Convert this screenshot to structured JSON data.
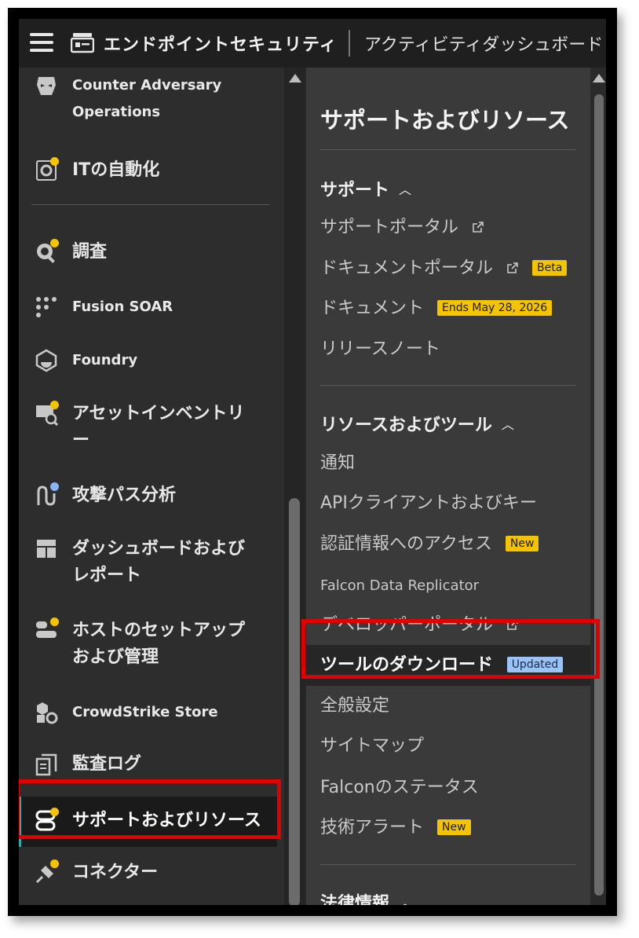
{
  "header": {
    "app_title": "エンドポイントセキュリティ",
    "page_title": "アクティビティダッシュボード"
  },
  "sidebar": {
    "items": [
      {
        "label": "Counter Adversary",
        "label2": "Operations",
        "icon": "mask-icon",
        "dot": null
      },
      {
        "label": "ITの自動化",
        "icon": "automation-gear-icon",
        "dot": "#f5c400"
      },
      {
        "label": "調査",
        "icon": "investigate-icon",
        "dot": "#f5c400"
      },
      {
        "label": "Fusion SOAR",
        "icon": "workflow-icon",
        "dot": null
      },
      {
        "label": "Foundry",
        "icon": "foundry-icon",
        "dot": null
      },
      {
        "label": "アセットインベントリ",
        "label2": "ー",
        "icon": "asset-inventory-icon",
        "dot": "#f5c400"
      },
      {
        "label": "攻撃パス分析",
        "icon": "attack-path-icon",
        "dot": "#8ab4f8"
      },
      {
        "label": "ダッシュボードおよび",
        "label2": "レポート",
        "icon": "dashboard-icon",
        "dot": null
      },
      {
        "label": "ホストのセットアップ",
        "label2": "および管理",
        "icon": "host-setup-icon",
        "dot": "#f5c400"
      },
      {
        "label": "CrowdStrike Store",
        "icon": "store-icon",
        "dot": null
      },
      {
        "label": "監査ログ",
        "icon": "audit-log-icon",
        "dot": null
      },
      {
        "label": "サポートおよびリソース",
        "icon": "support-icon",
        "dot": "#f5c400"
      },
      {
        "label": "コネクター",
        "icon": "connector-icon",
        "dot": "#f5c400"
      }
    ]
  },
  "panel": {
    "title": "サポートおよびリソース",
    "support_section": "サポート",
    "support_links": [
      {
        "label": "サポートポータル",
        "external": true
      },
      {
        "label": "ドキュメントポータル",
        "external": true,
        "badge": "Beta"
      },
      {
        "label": "ドキュメント",
        "badge": "Ends May 28, 2026"
      },
      {
        "label": "リリースノート"
      }
    ],
    "resources_section": "リソースおよびツール",
    "resource_links": [
      {
        "label": "通知"
      },
      {
        "label": "APIクライアントおよびキー"
      },
      {
        "label": "認証情報へのアクセス",
        "badge": "New"
      },
      {
        "label": "Falcon Data Replicator"
      },
      {
        "label": "デベロッパーポータル",
        "external": true
      },
      {
        "label": "ツールのダウンロード",
        "badge": "Updated"
      },
      {
        "label": "全般設定"
      },
      {
        "label": "サイトマップ"
      },
      {
        "label": "Falconのステータス"
      },
      {
        "label": "技術アラート",
        "badge": "New"
      }
    ],
    "legal_section": "法律情報"
  },
  "colors": {
    "highlight_border": "#e00000",
    "badge_yellow": "#f5c400",
    "badge_blue": "#9cc3f5"
  }
}
